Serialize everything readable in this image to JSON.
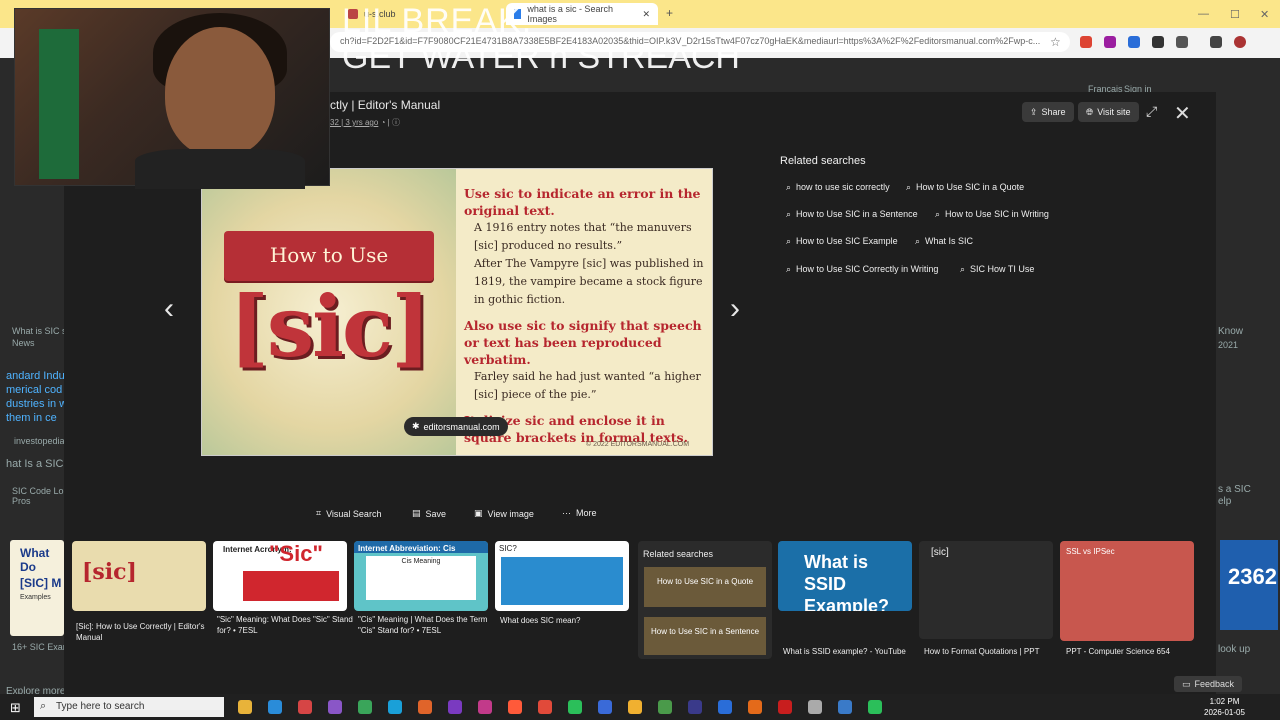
{
  "browser": {
    "tabs": [
      {
        "label": "u-s.club"
      },
      {
        "label": "what is a sic - Search Images"
      }
    ],
    "address": "ch?id=F2D2F1&id=F7F9080CF21E4731B8A7338E5BF2E4183A02035&thid=OIP.k3V_D2r15sTtw4F07cz70gHaEK&mediaurl=https%3A%2F%2Feditorsmanual.com%2Fwp-c..."
  },
  "stream_overlay": {
    "line1": "LIL BREAK,",
    "line2": "GET WATER n STREACH"
  },
  "background_page": {
    "left_texts": [
      "What is SIC s",
      "News",
      "andard Indus",
      "merical cod",
      "dustries in w",
      "them in ce",
      "investopedia",
      "hat Is a SIC",
      "SIC Code Lo",
      "Pros",
      "16+ SIC Exam",
      "What Do",
      "[SIC] M",
      "Examples"
    ],
    "right_texts": [
      "Francais",
      "Sign in",
      "Know",
      "2021",
      "s a SIC",
      "elp",
      "look up",
      "2362"
    ],
    "bottom_text": "Explore more searches like what is a sic"
  },
  "viewer": {
    "title": "ctly | Editor's Manual",
    "subtitle": "32 | 3 yrs ago",
    "share_label": "Share",
    "visit_label": "Visit site",
    "source_label": "editorsmanual.com",
    "image": {
      "banner": "How to Use",
      "big": "[sic]",
      "right_blocks": [
        {
          "type": "h",
          "text": "Use sic to indicate an error in the original text."
        },
        {
          "type": "p",
          "text": "A 1916 entry notes that “the manuvers [sic] produced no results.”"
        },
        {
          "type": "p",
          "text": "After The Vampyre [sic] was published in 1819, the vampire became a stock figure in gothic fiction."
        },
        {
          "type": "h",
          "text": "Also use sic to signify that speech or text has been reproduced verbatim."
        },
        {
          "type": "p",
          "text": "Farley said he had just wanted “a higher [sic] piece of the pie.”"
        },
        {
          "type": "h",
          "text": "Italicize sic and enclose it in square brackets in formal texts."
        }
      ],
      "footer": "© 2022 EDITORSMANUAL.COM"
    },
    "related": {
      "title": "Related searches",
      "chips": [
        "how to use sic correctly",
        "How to Use SIC in a Quote",
        "How to Use SIC in a Sentence",
        "How to Use SIC in Writing",
        "How to Use SIC Example",
        "What Is SIC",
        "How to Use SIC Correctly in Writing",
        "SIC How TI Use"
      ]
    },
    "actions": [
      "Visual Search",
      "Save",
      "View image",
      "More"
    ],
    "thumbs": [
      {
        "caption": "[Sic]: How to Use Correctly | Editor's Manual",
        "color": "#e9dcae"
      },
      {
        "caption": "\"Sic\" Meaning: What Does \"Sic\" Stand for? • 7ESL",
        "color": "#ffffff"
      },
      {
        "caption": "\"Cis\" Meaning | What Does the Term \"Cis\" Stand for? • 7ESL",
        "color": "#5fc4c8"
      },
      {
        "caption": "What does SIC mean?",
        "color": "#ffffff"
      },
      {
        "caption": "What is SSID example? - YouTube",
        "color": "#1b6fa8"
      },
      {
        "caption": "How to Format Quotations | PPT",
        "color": "#2b2b2b"
      },
      {
        "caption": "PPT - Computer Science 654",
        "color": "#c8574e"
      }
    ],
    "thumb_labels": {
      "internet": "Internet Acronym:",
      "sic_word": "\"Sic\"",
      "cis_title": "Internet Abbreviation: Cis",
      "cis_meaning": "Cis Meaning",
      "sic_q": "SIC?",
      "ssid_text": "What is SSID Example?",
      "bracket_sic": "[sic]",
      "ssl": "SSL vs IPSec"
    },
    "side_related": {
      "title": "Related searches",
      "items": [
        "How to Use SIC in a Quote",
        "How to Use SIC in a Sentence"
      ]
    }
  },
  "taskbar": {
    "search_placeholder": "Type here to search",
    "time": "1:02 PM",
    "date": "2026-01-05",
    "feedback": "Feedback"
  }
}
